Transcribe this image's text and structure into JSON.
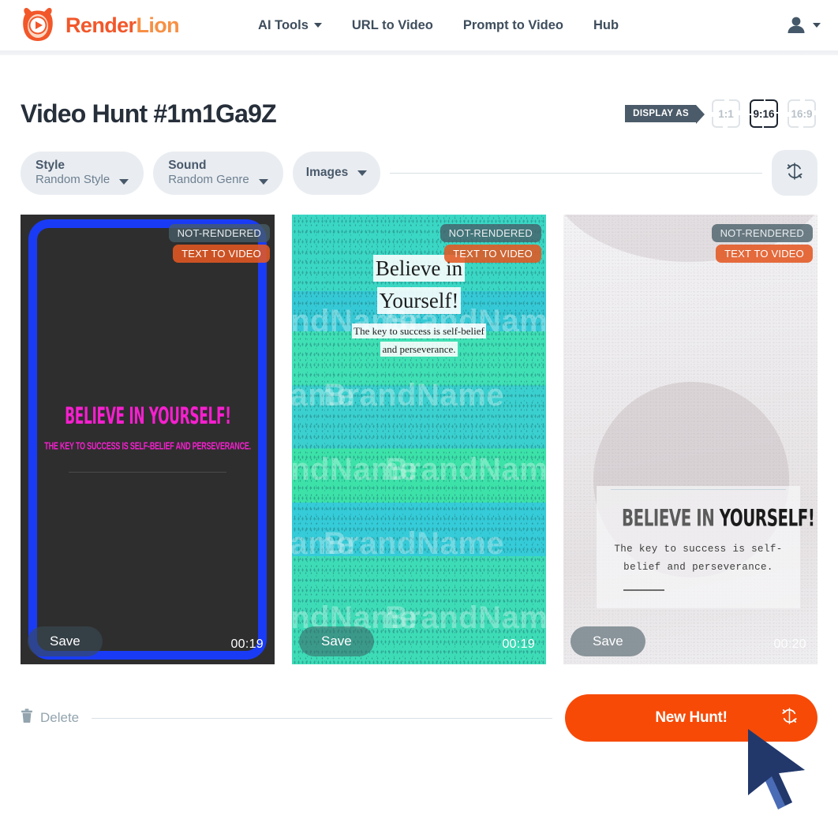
{
  "brand": {
    "name_part1": "Render",
    "name_part2": "Lion",
    "logo_icon": "lion-play-logo"
  },
  "nav": {
    "items": [
      {
        "label": "AI Tools",
        "has_dropdown": true
      },
      {
        "label": "URL to Video",
        "has_dropdown": false
      },
      {
        "label": "Prompt to Video",
        "has_dropdown": false
      },
      {
        "label": "Hub",
        "has_dropdown": false
      }
    ],
    "account_icon": "user-account-icon"
  },
  "page": {
    "title": "Video Hunt #1m1Ga9Z"
  },
  "display_as": {
    "tag_label": "DISPLAY AS",
    "options": [
      {
        "label": "1:1",
        "selected": false
      },
      {
        "label": "9:16",
        "selected": true
      },
      {
        "label": "16:9",
        "selected": false
      }
    ]
  },
  "filters": {
    "style": {
      "title": "Style",
      "value": "Random Style"
    },
    "sound": {
      "title": "Sound",
      "value": "Random Genre"
    },
    "images": {
      "title": "Images"
    },
    "refresh_icon": "refresh-icon"
  },
  "cards": [
    {
      "state_badge": "NOT-RENDERED",
      "kind_badge": "TEXT TO VIDEO",
      "save_label": "Save",
      "duration": "00:19",
      "headline": "BELIEVE IN YOURSELF!",
      "subline": "THE KEY TO SUCCESS IS SELF-BELIEF AND PERSEVERANCE."
    },
    {
      "state_badge": "NOT-RENDERED",
      "kind_badge": "TEXT TO VIDEO",
      "save_label": "Save",
      "duration": "00:19",
      "headline_line1": "Believe in",
      "headline_line2": "Yourself!",
      "subline_line1": "The key to success is self-belief",
      "subline_line2": "and perseverance.",
      "watermark_text": "BrandName"
    },
    {
      "state_badge": "NOT-RENDERED",
      "kind_badge": "TEXT TO VIDEO",
      "save_label": "Save",
      "duration": "00:20",
      "headline_light": "BELIEVE IN ",
      "headline_bold": "YOURSELF!",
      "subline_line1": "The key to success is self-",
      "subline_line2": "belief and perseverance."
    }
  ],
  "bottom": {
    "delete_label": "Delete",
    "delete_icon": "trash-icon",
    "new_hunt_label": "New Hunt!",
    "new_hunt_icon": "refresh-icon"
  },
  "colors": {
    "brand_orange": "#f2572a",
    "brand_orange_light": "#f79045",
    "cta_orange": "#f74a07",
    "nav_text": "#3e4d5c",
    "title_text": "#262f3a",
    "pill_bg": "#e9edf1",
    "card1_accent": "#1a3bf5",
    "card1_text": "#f61fcf",
    "cursor_blue": "#4a6bb5",
    "cursor_navy": "#22386b"
  }
}
